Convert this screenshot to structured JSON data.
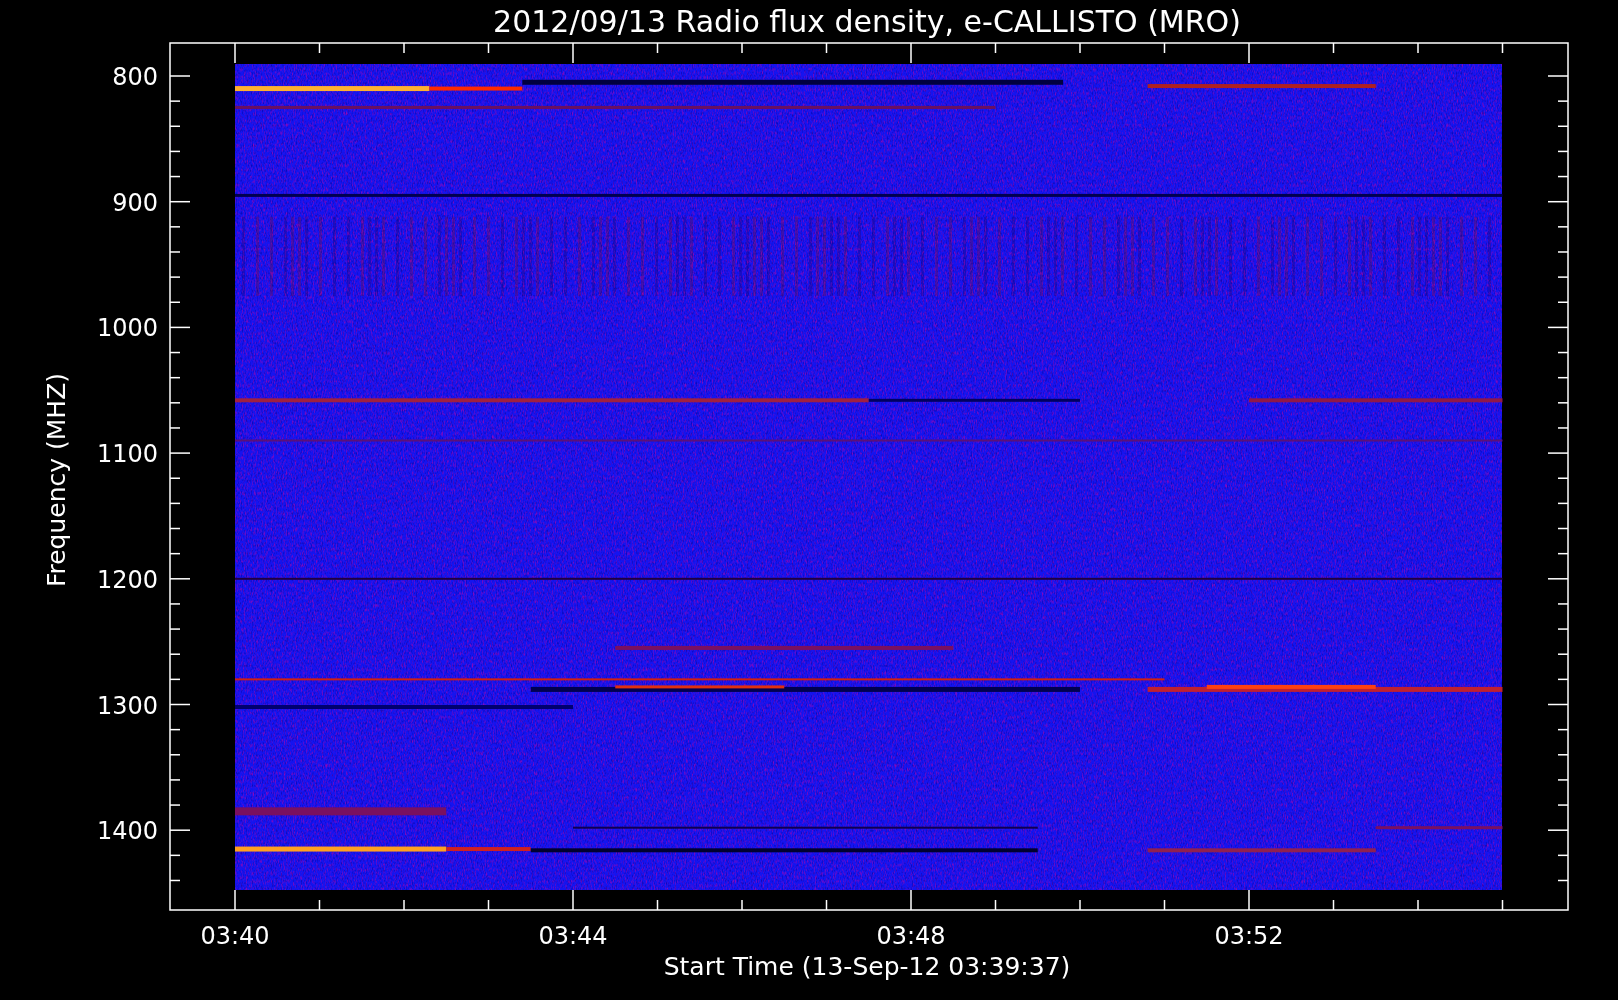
{
  "title": "2012/09/13  Radio flux density, e-CALLISTO (MRO)",
  "y_axis": {
    "label": "Frequency (MHZ)",
    "ticks": [
      "800",
      "900",
      "1000",
      "1100",
      "1200",
      "1300",
      "1400"
    ]
  },
  "x_axis": {
    "label": "Start Time (13-Sep-12 03:39:37)",
    "ticks": [
      "03:40",
      "03:44",
      "03:48",
      "03:52"
    ]
  }
}
